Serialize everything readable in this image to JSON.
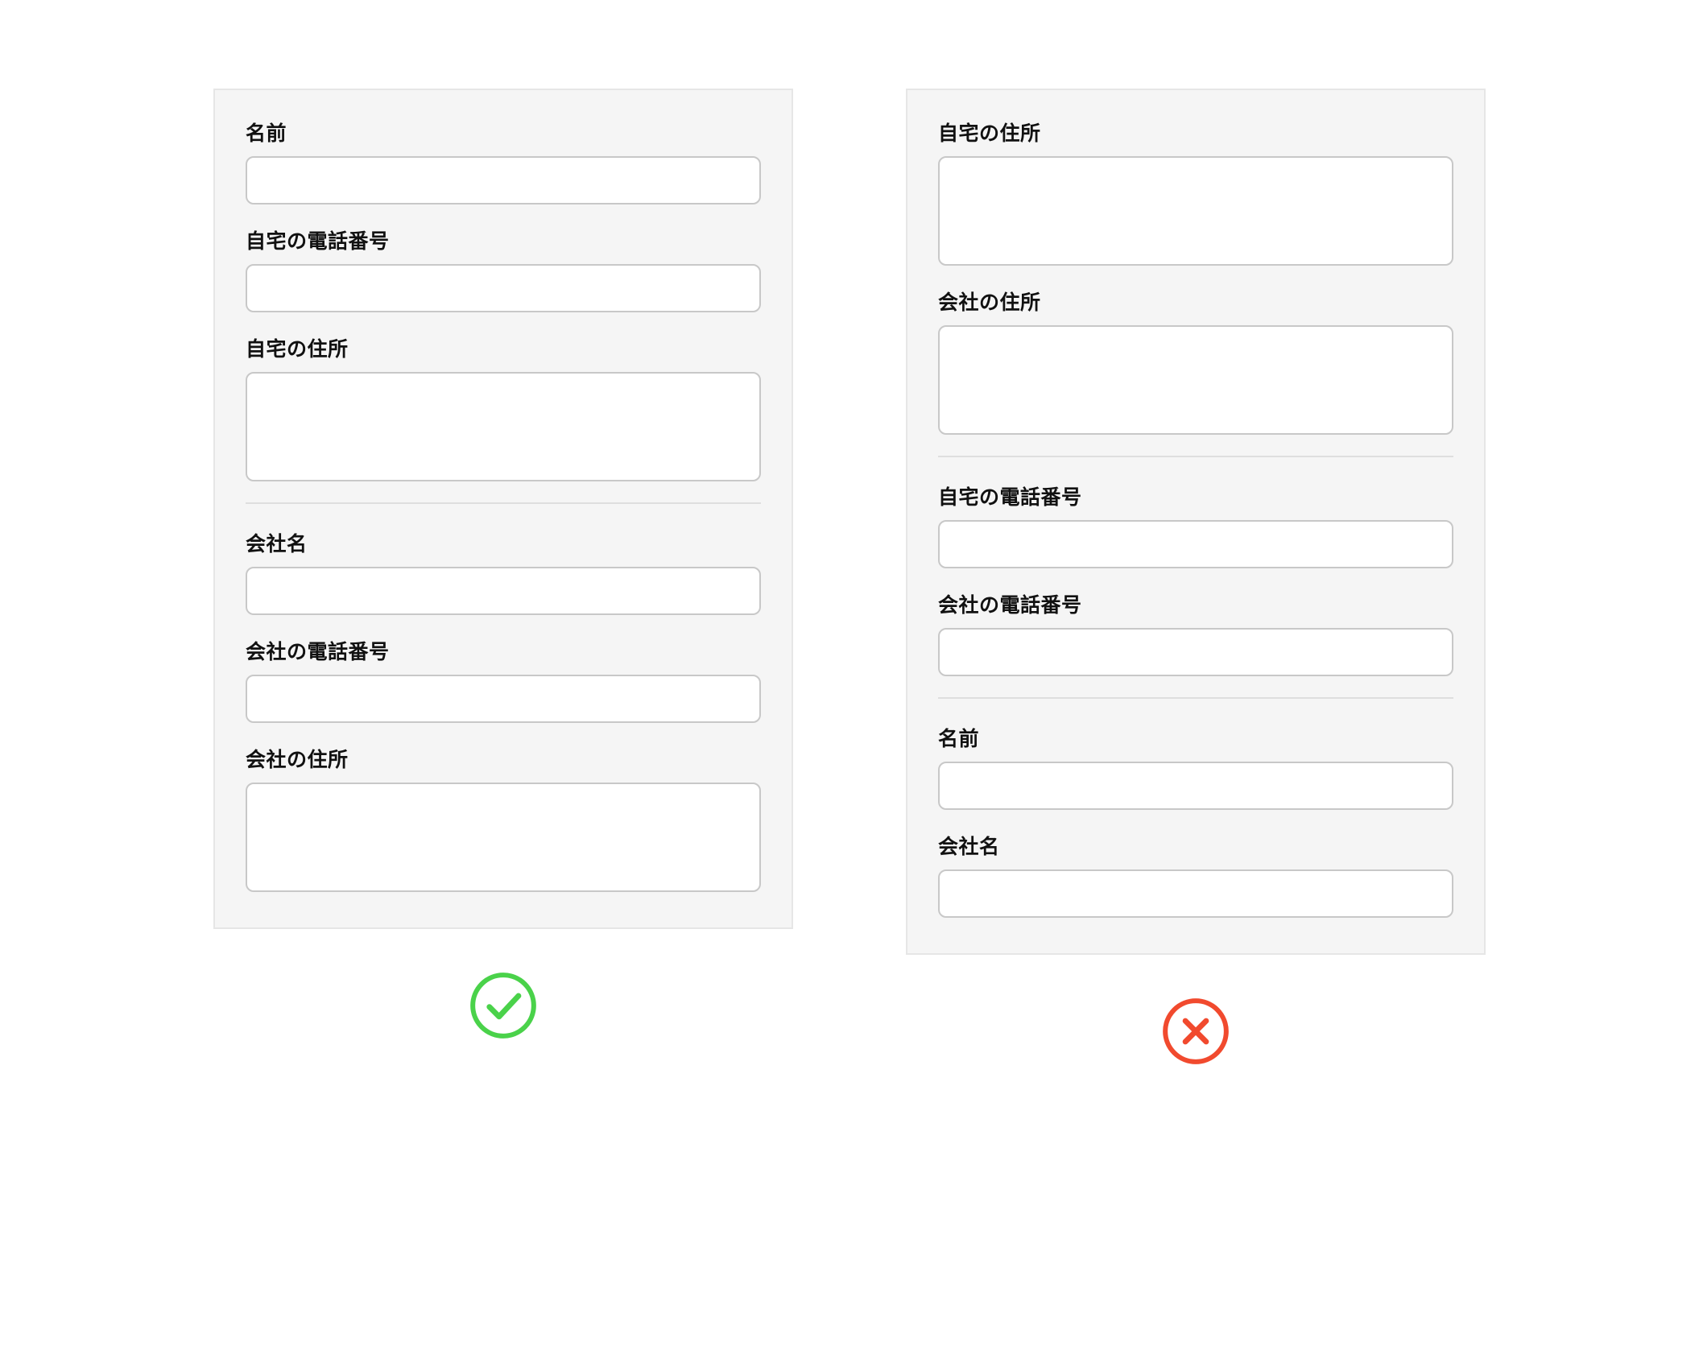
{
  "good_form": {
    "groups": [
      {
        "fields": [
          {
            "key": "name",
            "label": "名前",
            "type": "single"
          },
          {
            "key": "home_phone",
            "label": "自宅の電話番号",
            "type": "single"
          },
          {
            "key": "home_address",
            "label": "自宅の住所",
            "type": "multi"
          }
        ]
      },
      {
        "fields": [
          {
            "key": "company_name",
            "label": "会社名",
            "type": "single"
          },
          {
            "key": "company_phone",
            "label": "会社の電話番号",
            "type": "single"
          },
          {
            "key": "company_address",
            "label": "会社の住所",
            "type": "multi"
          }
        ]
      }
    ],
    "status": "good"
  },
  "bad_form": {
    "groups": [
      {
        "fields": [
          {
            "key": "home_address",
            "label": "自宅の住所",
            "type": "multi"
          },
          {
            "key": "company_address",
            "label": "会社の住所",
            "type": "multi"
          }
        ]
      },
      {
        "fields": [
          {
            "key": "home_phone",
            "label": "自宅の電話番号",
            "type": "single"
          },
          {
            "key": "company_phone",
            "label": "会社の電話番号",
            "type": "single"
          }
        ]
      },
      {
        "fields": [
          {
            "key": "name",
            "label": "名前",
            "type": "single"
          },
          {
            "key": "company_name",
            "label": "会社名",
            "type": "single"
          }
        ]
      }
    ],
    "status": "bad"
  },
  "colors": {
    "good": "#4ad24a",
    "bad": "#f14a2e",
    "panel_bg": "#f5f5f5",
    "panel_border": "#e6e6e6",
    "input_border": "#c8c8c8"
  }
}
